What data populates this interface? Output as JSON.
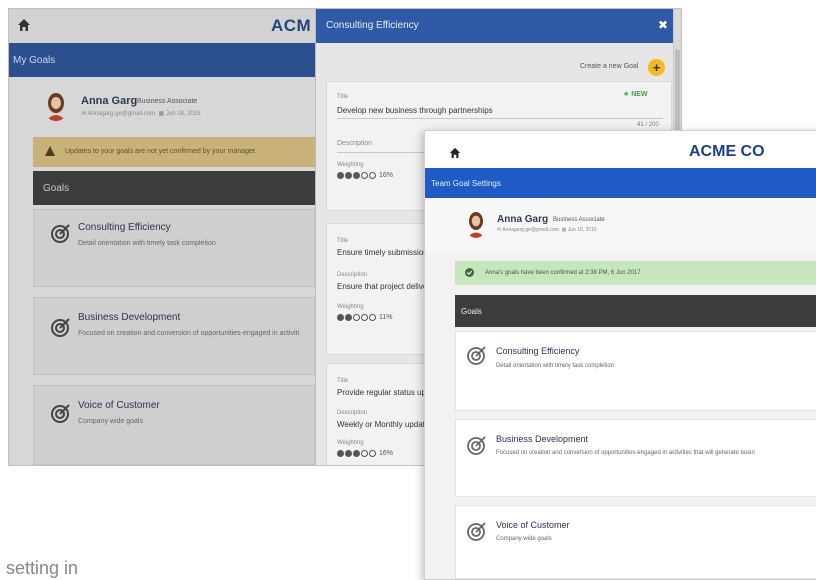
{
  "back": {
    "brand": "ACM",
    "nav_label": "My Goals",
    "user_name": "Anna Garg",
    "user_role": "Business Associate",
    "user_email": "Annagarg.ge@gmail.com",
    "user_date": "Jun 18, 2016",
    "warning": "Updates to your goals are not yet confirmed by your manager.",
    "goals_header": "Goals",
    "goals": [
      {
        "title": "Consulting Efficiency",
        "desc": "Detail orientation with timely task completion"
      },
      {
        "title": "Business Development",
        "desc": "Focused on creation and conversion of opportunities-engaged in activiti"
      },
      {
        "title": "Voice of Customer",
        "desc": "Company wide goals"
      }
    ]
  },
  "modal": {
    "title": "Consulting Efficiency",
    "close": "✖",
    "create_label": "Create a new Goal",
    "plus": "+",
    "cards": [
      {
        "title_label": "Title",
        "title_value": "Develop new business through partnerships",
        "new_badge": "NEW",
        "counter": "41 / 200",
        "desc_label": "Description",
        "desc_value": "",
        "weight_label": "Weighting",
        "filled": 3,
        "pct": "16%"
      },
      {
        "title_label": "Title",
        "title_value": "Ensure timely submission c",
        "desc_label": "Description",
        "desc_value": "Ensure that project deliver",
        "weight_label": "Weighting",
        "filled": 2,
        "pct": "11%"
      },
      {
        "title_label": "Title",
        "title_value": "Provide regular status upda",
        "desc_label": "Description",
        "desc_value": "Weekly or Monthly update",
        "weight_label": "Weighting",
        "filled": 3,
        "pct": "16%"
      }
    ]
  },
  "front": {
    "brand": "ACME CO",
    "nav_label": "Team Goal Settings",
    "user_name": "Anna Garg",
    "user_role": "Business Associate",
    "user_email": "Annagarg.ge@gmail.com",
    "user_date": "Jun 18, 2016",
    "confirmation": "Anna's goals have been confirmed at 2:38 PM, 6 Jun 2017",
    "goals_header": "Goals",
    "goals": [
      {
        "title": "Consulting Efficiency",
        "desc": "Detail orientation with timely task completion"
      },
      {
        "title": "Business Development",
        "desc": "Focused on creation and conversion of opportunities-engaged in activities that will generate busin"
      },
      {
        "title": "Voice of Customer",
        "desc": "Company wide goals"
      }
    ]
  },
  "caption": "setting in",
  "colors": {
    "accent_blue": "#1f5bc4",
    "warning": "#c9b27a",
    "success": "#c7e6bd",
    "plus_button": "#f5b820"
  }
}
